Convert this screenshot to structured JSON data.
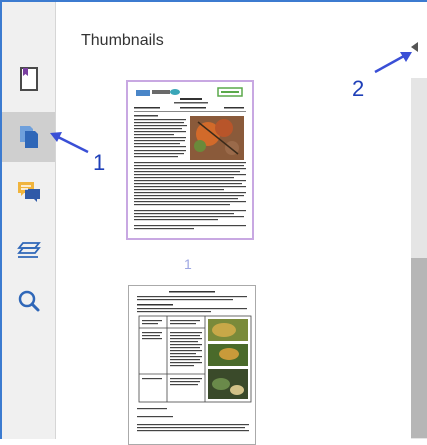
{
  "panel": {
    "title": "Thumbnails"
  },
  "toolbar": {
    "tools": [
      {
        "name": "page-icon",
        "active": false
      },
      {
        "name": "thumbnails-icon",
        "active": true
      },
      {
        "name": "comments-icon",
        "active": false
      },
      {
        "name": "layers-icon",
        "active": false
      },
      {
        "name": "search-icon",
        "active": false
      }
    ]
  },
  "thumbnails": [
    {
      "page_number": "1",
      "selected": true
    },
    {
      "page_number": "",
      "selected": false
    }
  ],
  "annotations": {
    "label_1": "1",
    "label_2": "2"
  },
  "colors": {
    "accent": "#3c7bd0",
    "arrow": "#3a4fd6",
    "selected_border": "#c8a8e2",
    "page_number": "#9da7e2",
    "comment": "#f0b43d"
  }
}
